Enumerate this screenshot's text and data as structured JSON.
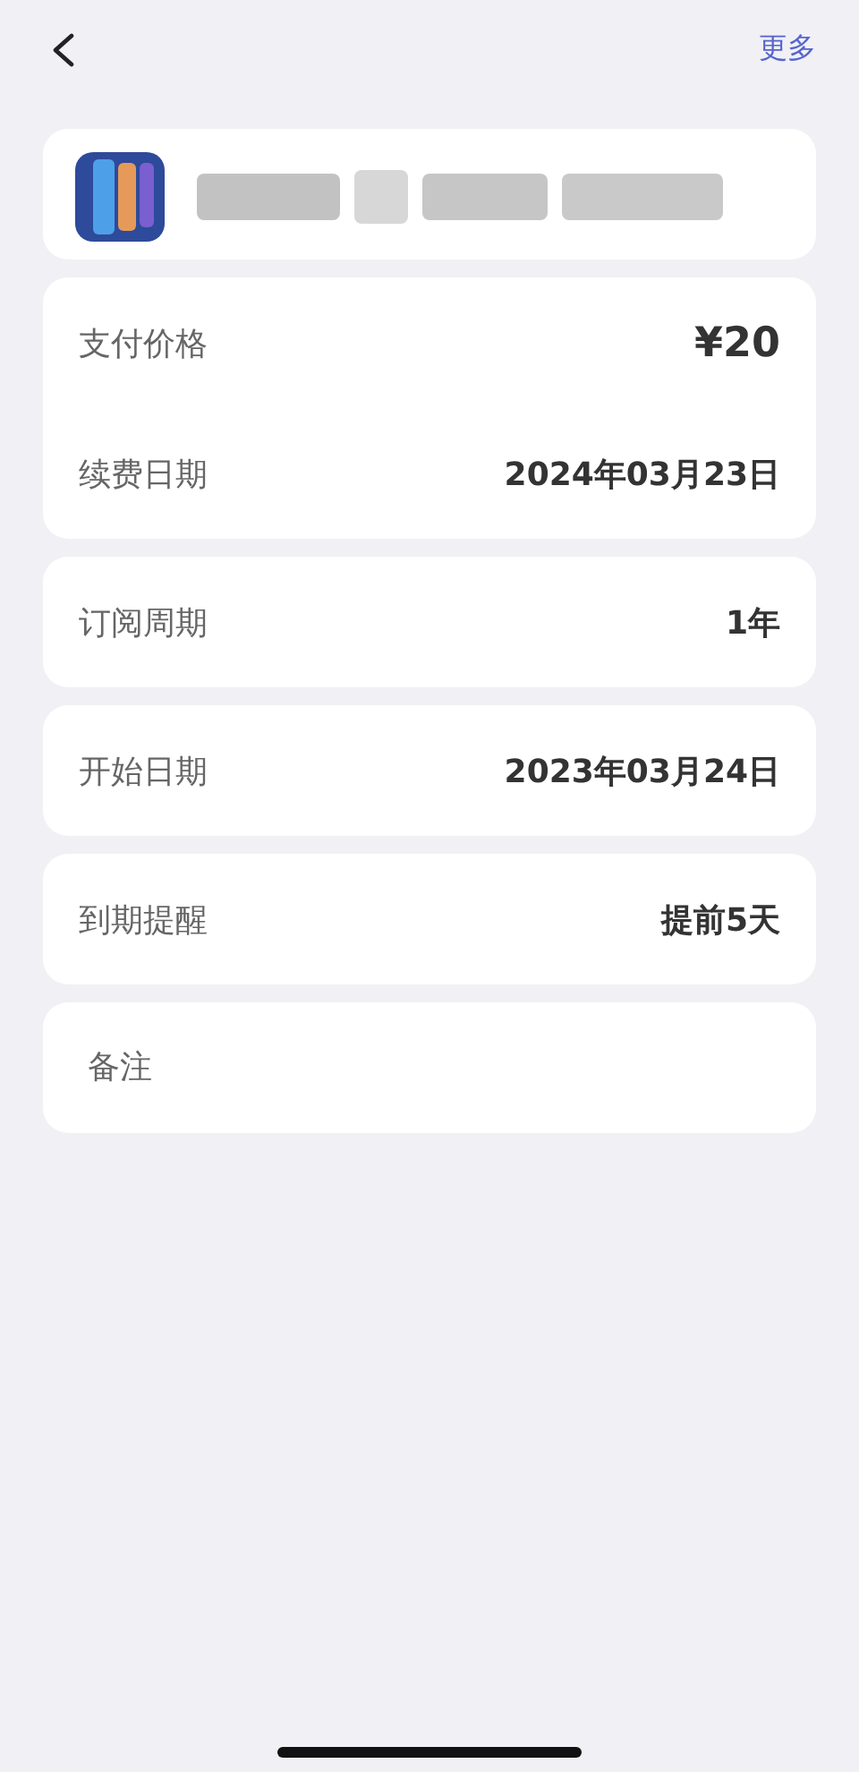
{
  "header": {
    "action": "更多"
  },
  "groups": [
    [
      {
        "label": "支付价格",
        "value": "¥20",
        "kind": "price"
      },
      {
        "label": "续费日期",
        "value": "2024年03月23日",
        "kind": "plain"
      }
    ],
    [
      {
        "label": "订阅周期",
        "value": "1年",
        "kind": "plain"
      }
    ],
    [
      {
        "label": "开始日期",
        "value": "2023年03月24日",
        "kind": "plain"
      }
    ],
    [
      {
        "label": "到期提醒",
        "value": "提前5天",
        "kind": "plain"
      }
    ]
  ],
  "note": {
    "placeholder": "备注"
  }
}
